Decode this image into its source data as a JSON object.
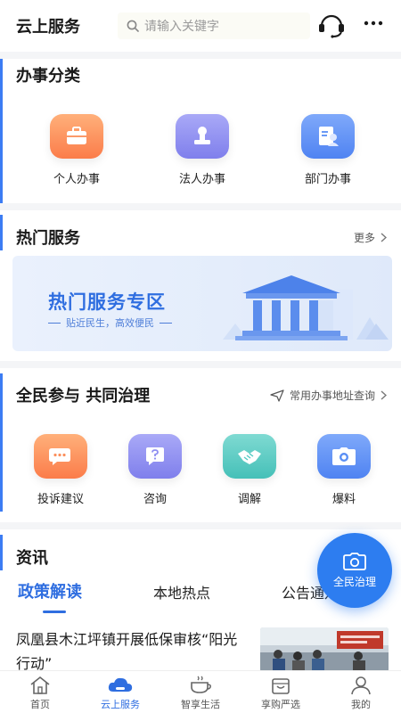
{
  "header": {
    "title": "云上服务",
    "search_placeholder": "请输入关键字",
    "icons": [
      "search-icon",
      "customer-service-icon",
      "more-icon"
    ]
  },
  "categories": {
    "title": "办事分类",
    "items": [
      {
        "label": "个人办事",
        "icon": "briefcase-icon",
        "color": "#fb8f5c"
      },
      {
        "label": "法人办事",
        "icon": "seal-icon",
        "color": "#8f8ff2"
      },
      {
        "label": "部门办事",
        "icon": "document-person-icon",
        "color": "#5a8ff5"
      }
    ]
  },
  "hot_services": {
    "title": "热门服务",
    "more_label": "更多",
    "banner": {
      "title": "热门服务专区",
      "subtitle": "贴近民生，高效便民"
    }
  },
  "governance": {
    "title": "全民参与 共同治理",
    "link_label": "常用办事地址查询",
    "items": [
      {
        "label": "投诉建议",
        "icon": "chat-bubble-icon",
        "color": "#fb8f5c"
      },
      {
        "label": "咨询",
        "icon": "question-icon",
        "color": "#8f8ff2"
      },
      {
        "label": "调解",
        "icon": "handshake-icon",
        "color": "#4fc9c2"
      },
      {
        "label": "爆料",
        "icon": "camera-icon",
        "color": "#5a8ff5"
      }
    ]
  },
  "news": {
    "title": "资讯",
    "tabs": [
      {
        "label": "政策解读",
        "active": true
      },
      {
        "label": "本地热点",
        "active": false
      },
      {
        "label": "公告通知",
        "active": false
      }
    ],
    "article": {
      "title": "凤凰县木江坪镇开展低保审核“阳光行动”"
    }
  },
  "fab": {
    "label": "全民治理",
    "icon": "camera-icon"
  },
  "bottom_nav": [
    {
      "label": "首页",
      "icon": "home-icon",
      "active": false
    },
    {
      "label": "云上服务",
      "icon": "cloud-service-icon",
      "active": true
    },
    {
      "label": "智享生活",
      "icon": "tea-cup-icon",
      "active": false
    },
    {
      "label": "享购严选",
      "icon": "shopping-bag-icon",
      "active": false
    },
    {
      "label": "我的",
      "icon": "user-icon",
      "active": false
    }
  ],
  "colors": {
    "accent": "#2f6ee0",
    "fab": "#2d7df0"
  }
}
